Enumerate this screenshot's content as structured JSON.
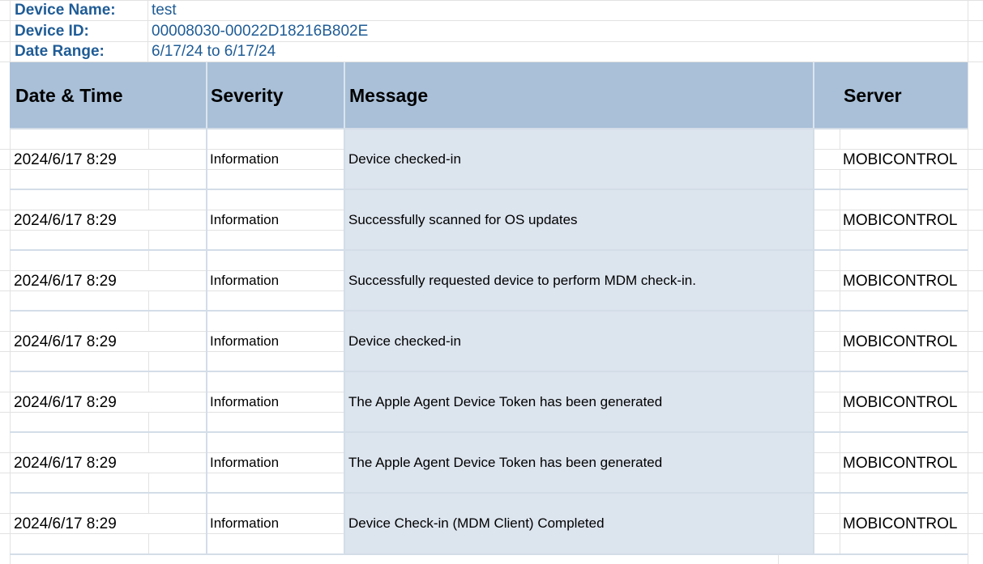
{
  "meta": {
    "device_name_label": "Device Name:",
    "device_name": "test",
    "device_id_label": "Device ID:",
    "device_id": "00008030-00022D18216B802E",
    "date_range_label": "Date Range:",
    "date_range": "6/17/24 to 6/17/24"
  },
  "columns": {
    "date_time": "Date & Time",
    "severity": "Severity",
    "message": "Message",
    "server": "Server"
  },
  "rows": [
    {
      "date_time": "2024/6/17 8:29",
      "severity": "Information",
      "message": "Device checked-in",
      "server": "MOBICONTROL"
    },
    {
      "date_time": "2024/6/17 8:29",
      "severity": "Information",
      "message": "Successfully scanned for OS updates",
      "server": "MOBICONTROL"
    },
    {
      "date_time": "2024/6/17 8:29",
      "severity": "Information",
      "message": "Successfully requested device to perform MDM check-in.",
      "server": "MOBICONTROL"
    },
    {
      "date_time": "2024/6/17 8:29",
      "severity": "Information",
      "message": "Device checked-in",
      "server": "MOBICONTROL"
    },
    {
      "date_time": "2024/6/17 8:29",
      "severity": "Information",
      "message": "The Apple Agent Device Token has been generated",
      "server": "MOBICONTROL"
    },
    {
      "date_time": "2024/6/17 8:29",
      "severity": "Information",
      "message": "The Apple Agent Device Token has been generated",
      "server": "MOBICONTROL"
    },
    {
      "date_time": "2024/6/17 8:29",
      "severity": "Information",
      "message": "Device Check-in (MDM Client) Completed",
      "server": "MOBICONTROL"
    }
  ],
  "colors": {
    "label_blue": "#1f5c96",
    "header_fill": "#a9c0d8",
    "message_fill": "#dce4ee"
  }
}
